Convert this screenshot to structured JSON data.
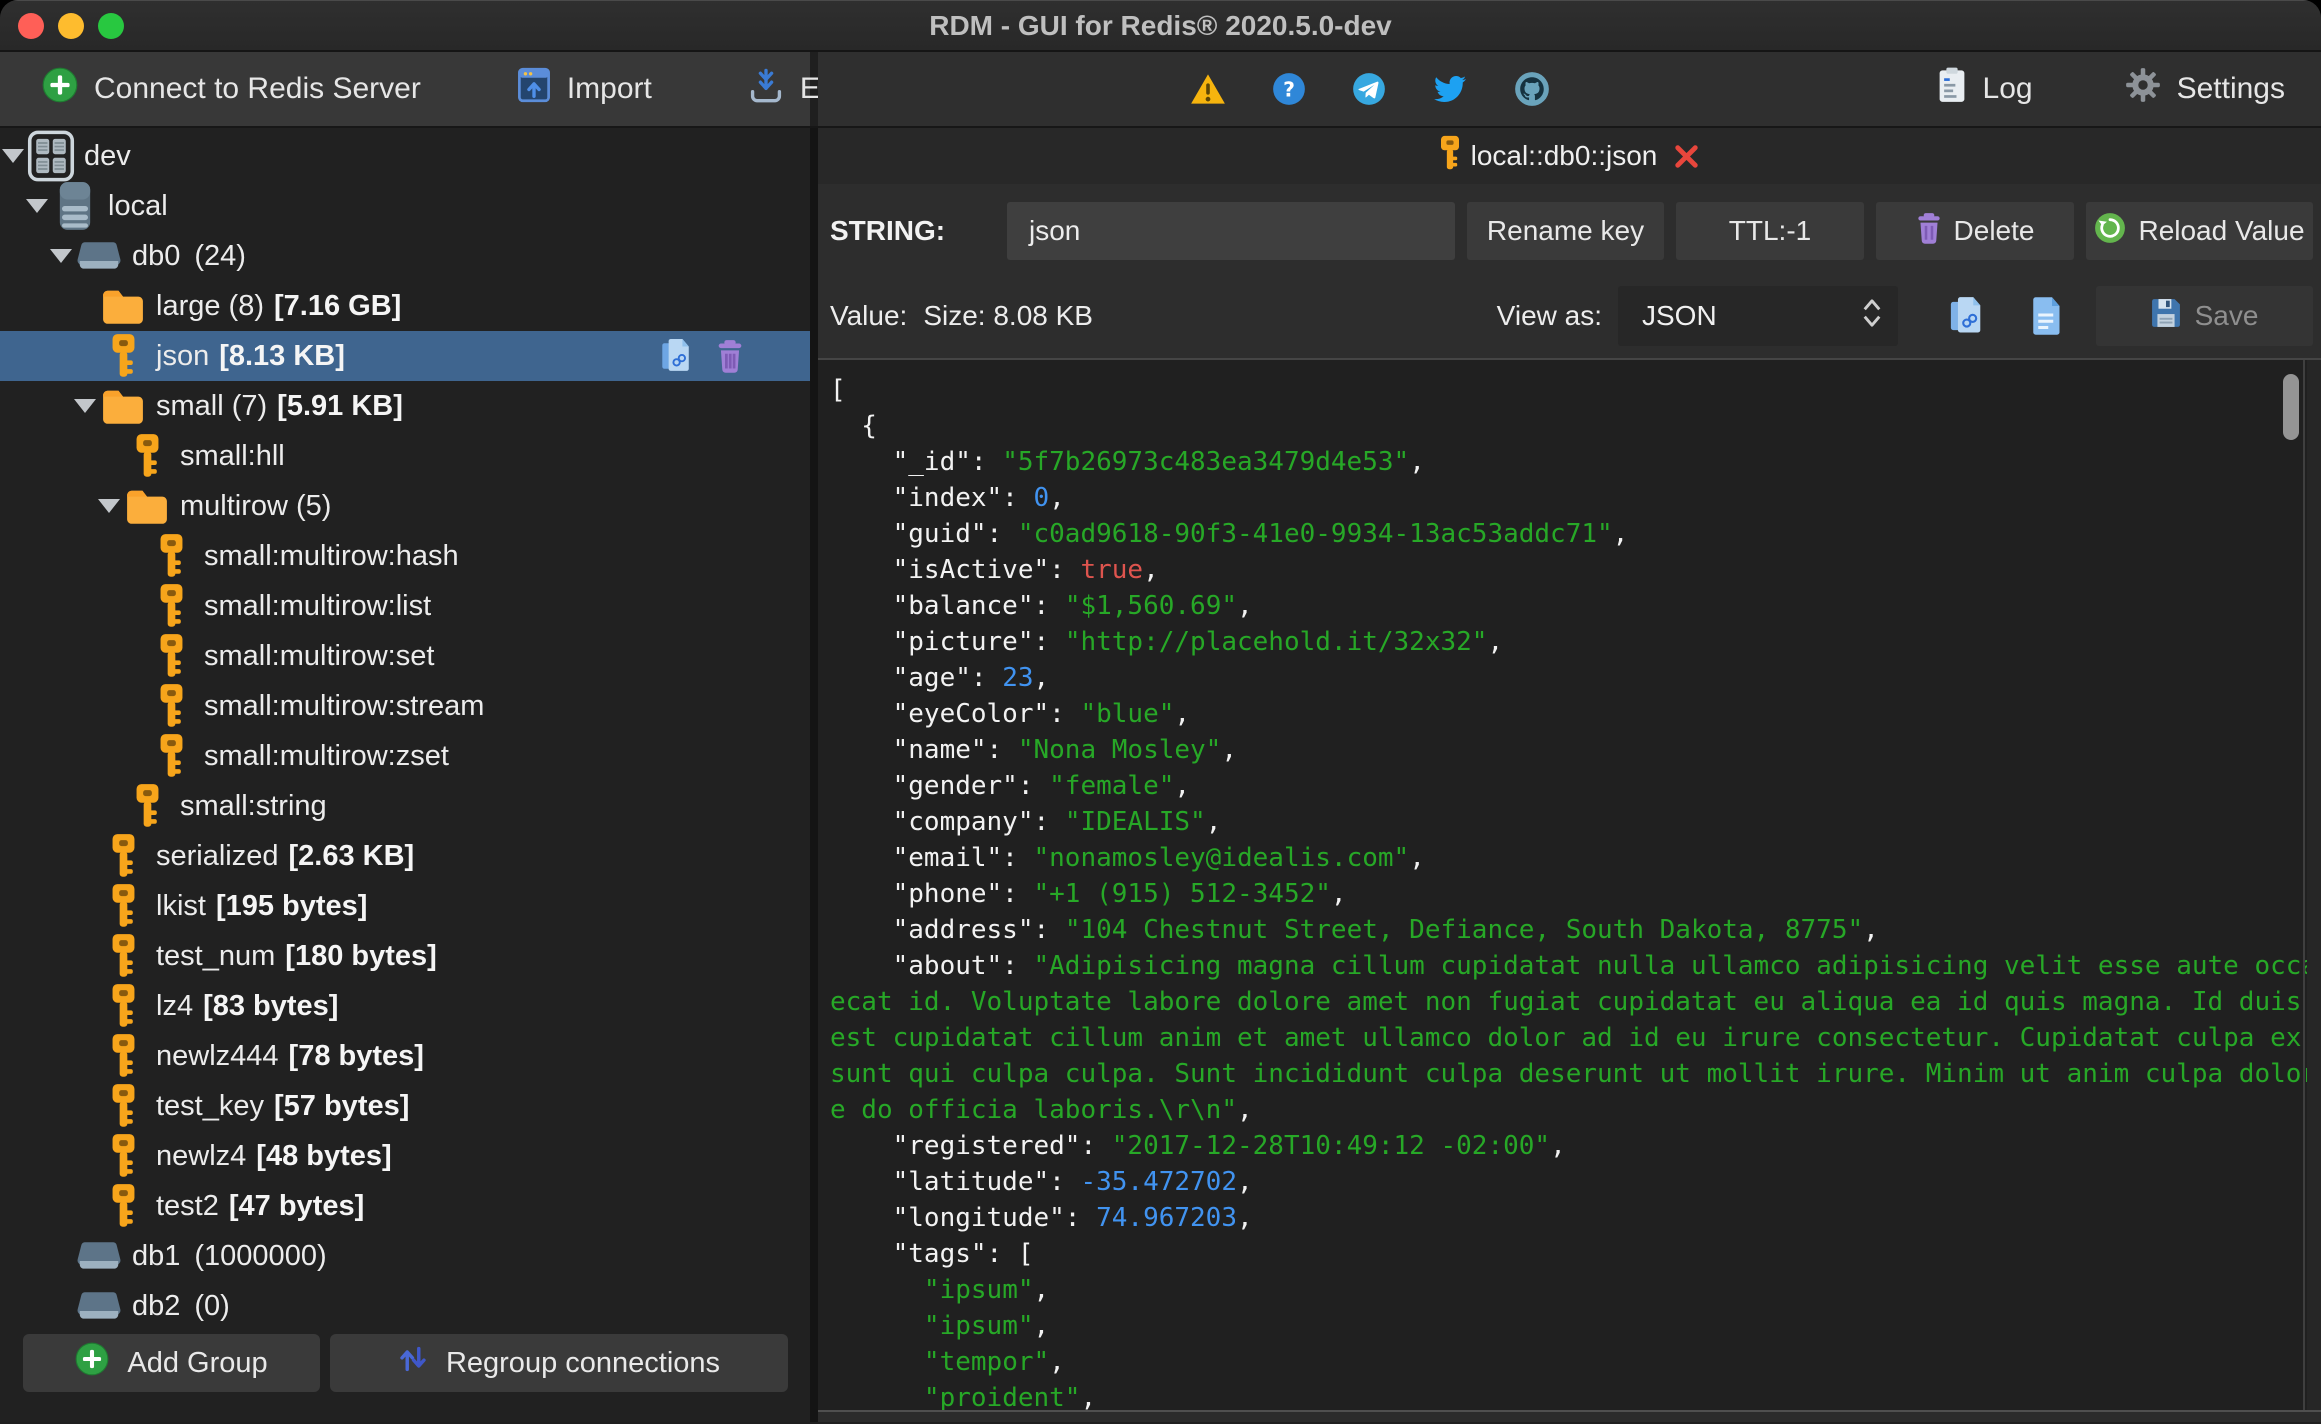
{
  "window": {
    "title": "RDM - GUI for Redis® 2020.5.0-dev"
  },
  "toolbar": {
    "connect_label": "Connect to Redis Server",
    "import_label": "Import",
    "export_label": "Export",
    "log_label": "Log",
    "settings_label": "Settings"
  },
  "sidebar": {
    "tree": [
      {
        "label": "dev",
        "type": "server",
        "level": 0,
        "expanded": true
      },
      {
        "label": "local",
        "type": "database",
        "level": 1,
        "expanded": true
      },
      {
        "label": "db0",
        "count": "(24)",
        "type": "db",
        "level": 2,
        "expanded": true
      },
      {
        "label": "large (8)",
        "size": "[7.16 GB]",
        "type": "folder",
        "level": 3
      },
      {
        "label": "json",
        "size": "[8.13 KB]",
        "type": "key",
        "level": 3,
        "selected": true
      },
      {
        "label": "small (7)",
        "size": "[5.91 KB]",
        "type": "folder",
        "level": 3,
        "expanded": true
      },
      {
        "label": "small:hll",
        "type": "key",
        "level": 4
      },
      {
        "label": "multirow (5)",
        "type": "folder",
        "level": 4,
        "expanded": true
      },
      {
        "label": "small:multirow:hash",
        "type": "key",
        "level": 5
      },
      {
        "label": "small:multirow:list",
        "type": "key",
        "level": 5
      },
      {
        "label": "small:multirow:set",
        "type": "key",
        "level": 5
      },
      {
        "label": "small:multirow:stream",
        "type": "key",
        "level": 5
      },
      {
        "label": "small:multirow:zset",
        "type": "key",
        "level": 5
      },
      {
        "label": "small:string",
        "type": "key",
        "level": 4
      },
      {
        "label": "serialized",
        "size": "[2.63 KB]",
        "type": "key",
        "level": 3
      },
      {
        "label": "lkist",
        "size": "[195 bytes]",
        "type": "key",
        "level": 3
      },
      {
        "label": "test_num",
        "size": "[180 bytes]",
        "type": "key",
        "level": 3
      },
      {
        "label": "lz4",
        "size": "[83 bytes]",
        "type": "key",
        "level": 3
      },
      {
        "label": "newlz444",
        "size": "[78 bytes]",
        "type": "key",
        "level": 3
      },
      {
        "label": "test_key",
        "size": "[57 bytes]",
        "type": "key",
        "level": 3
      },
      {
        "label": "newlz4",
        "size": "[48 bytes]",
        "type": "key",
        "level": 3
      },
      {
        "label": "test2",
        "size": "[47 bytes]",
        "type": "key",
        "level": 3
      },
      {
        "label": "db1",
        "count": "(1000000)",
        "type": "db",
        "level": 2
      },
      {
        "label": "db2",
        "count": "(0)",
        "type": "db",
        "level": 2
      }
    ],
    "add_group_label": "Add Group",
    "regroup_label": "Regroup connections"
  },
  "tab": {
    "title": "local::db0::json"
  },
  "key_editor": {
    "type_label": "STRING:",
    "key_name": "json",
    "rename_label": "Rename key",
    "ttl_label": "TTL:-1",
    "delete_label": "Delete",
    "reload_label": "Reload Value",
    "value_label": "Value:",
    "size_label": "Size: 8.08 KB",
    "view_as_label": "View as:",
    "view_as_value": "JSON",
    "save_label": "Save"
  },
  "colors": {
    "selection_blue": "#3f658f",
    "string_green": "#27a827",
    "number_blue": "#4193f0",
    "bool_red": "#de544e",
    "key_orange": "#f7a51b"
  },
  "editor": {
    "lines": [
      [
        [
          "w",
          "["
        ]
      ],
      [
        [
          "w",
          "  {"
        ]
      ],
      [
        [
          "w",
          "    \"_id\": "
        ],
        [
          "g",
          "\"5f7b26973c483ea3479d4e53\""
        ],
        [
          "w",
          ","
        ]
      ],
      [
        [
          "w",
          "    \"index\": "
        ],
        [
          "n",
          "0"
        ],
        [
          "w",
          ","
        ]
      ],
      [
        [
          "w",
          "    \"guid\": "
        ],
        [
          "g",
          "\"c0ad9618-90f3-41e0-9934-13ac53addc71\""
        ],
        [
          "w",
          ","
        ]
      ],
      [
        [
          "w",
          "    \"isActive\": "
        ],
        [
          "r",
          "true"
        ],
        [
          "w",
          ","
        ]
      ],
      [
        [
          "w",
          "    \"balance\": "
        ],
        [
          "g",
          "\"$1,560.69\""
        ],
        [
          "w",
          ","
        ]
      ],
      [
        [
          "w",
          "    \"picture\": "
        ],
        [
          "g",
          "\"http://placehold.it/32x32\""
        ],
        [
          "w",
          ","
        ]
      ],
      [
        [
          "w",
          "    \"age\": "
        ],
        [
          "n",
          "23"
        ],
        [
          "w",
          ","
        ]
      ],
      [
        [
          "w",
          "    \"eyeColor\": "
        ],
        [
          "g",
          "\"blue\""
        ],
        [
          "w",
          ","
        ]
      ],
      [
        [
          "w",
          "    \"name\": "
        ],
        [
          "g",
          "\"Nona Mosley\""
        ],
        [
          "w",
          ","
        ]
      ],
      [
        [
          "w",
          "    \"gender\": "
        ],
        [
          "g",
          "\"female\""
        ],
        [
          "w",
          ","
        ]
      ],
      [
        [
          "w",
          "    \"company\": "
        ],
        [
          "g",
          "\"IDEALIS\""
        ],
        [
          "w",
          ","
        ]
      ],
      [
        [
          "w",
          "    \"email\": "
        ],
        [
          "g",
          "\"nonamosley@idealis.com\""
        ],
        [
          "w",
          ","
        ]
      ],
      [
        [
          "w",
          "    \"phone\": "
        ],
        [
          "g",
          "\"+1 (915) 512-3452\""
        ],
        [
          "w",
          ","
        ]
      ],
      [
        [
          "w",
          "    \"address\": "
        ],
        [
          "g",
          "\"104 Chestnut Street, Defiance, South Dakota, 8775\""
        ],
        [
          "w",
          ","
        ]
      ],
      [
        [
          "w",
          "    \"about\": "
        ],
        [
          "g",
          "\"Adipisicing magna cillum cupidatat nulla ullamco adipisicing velit esse aute occa"
        ]
      ],
      [
        [
          "g",
          "ecat id. Voluptate labore dolore amet non fugiat cupidatat eu aliqua ea id quis magna. Id duis "
        ]
      ],
      [
        [
          "g",
          "est cupidatat cillum anim et amet ullamco dolor ad id eu irure consectetur. Cupidatat culpa ex "
        ]
      ],
      [
        [
          "g",
          "sunt qui culpa culpa. Sunt incididunt culpa deserunt ut mollit irure. Minim ut anim culpa dolor"
        ]
      ],
      [
        [
          "g",
          "e do officia laboris.\\r\\n\""
        ],
        [
          "w",
          ","
        ]
      ],
      [
        [
          "w",
          "    \"registered\": "
        ],
        [
          "g",
          "\"2017-12-28T10:49:12 -02:00\""
        ],
        [
          "w",
          ","
        ]
      ],
      [
        [
          "w",
          "    \"latitude\": "
        ],
        [
          "n",
          "-35.472702"
        ],
        [
          "w",
          ","
        ]
      ],
      [
        [
          "w",
          "    \"longitude\": "
        ],
        [
          "n",
          "74.967203"
        ],
        [
          "w",
          ","
        ]
      ],
      [
        [
          "w",
          "    \"tags\": ["
        ]
      ],
      [
        [
          "w",
          "      "
        ],
        [
          "g",
          "\"ipsum\""
        ],
        [
          "w",
          ","
        ]
      ],
      [
        [
          "w",
          "      "
        ],
        [
          "g",
          "\"ipsum\""
        ],
        [
          "w",
          ","
        ]
      ],
      [
        [
          "w",
          "      "
        ],
        [
          "g",
          "\"tempor\""
        ],
        [
          "w",
          ","
        ]
      ],
      [
        [
          "w",
          "      "
        ],
        [
          "g",
          "\"proident\""
        ],
        [
          "w",
          ","
        ]
      ]
    ]
  }
}
